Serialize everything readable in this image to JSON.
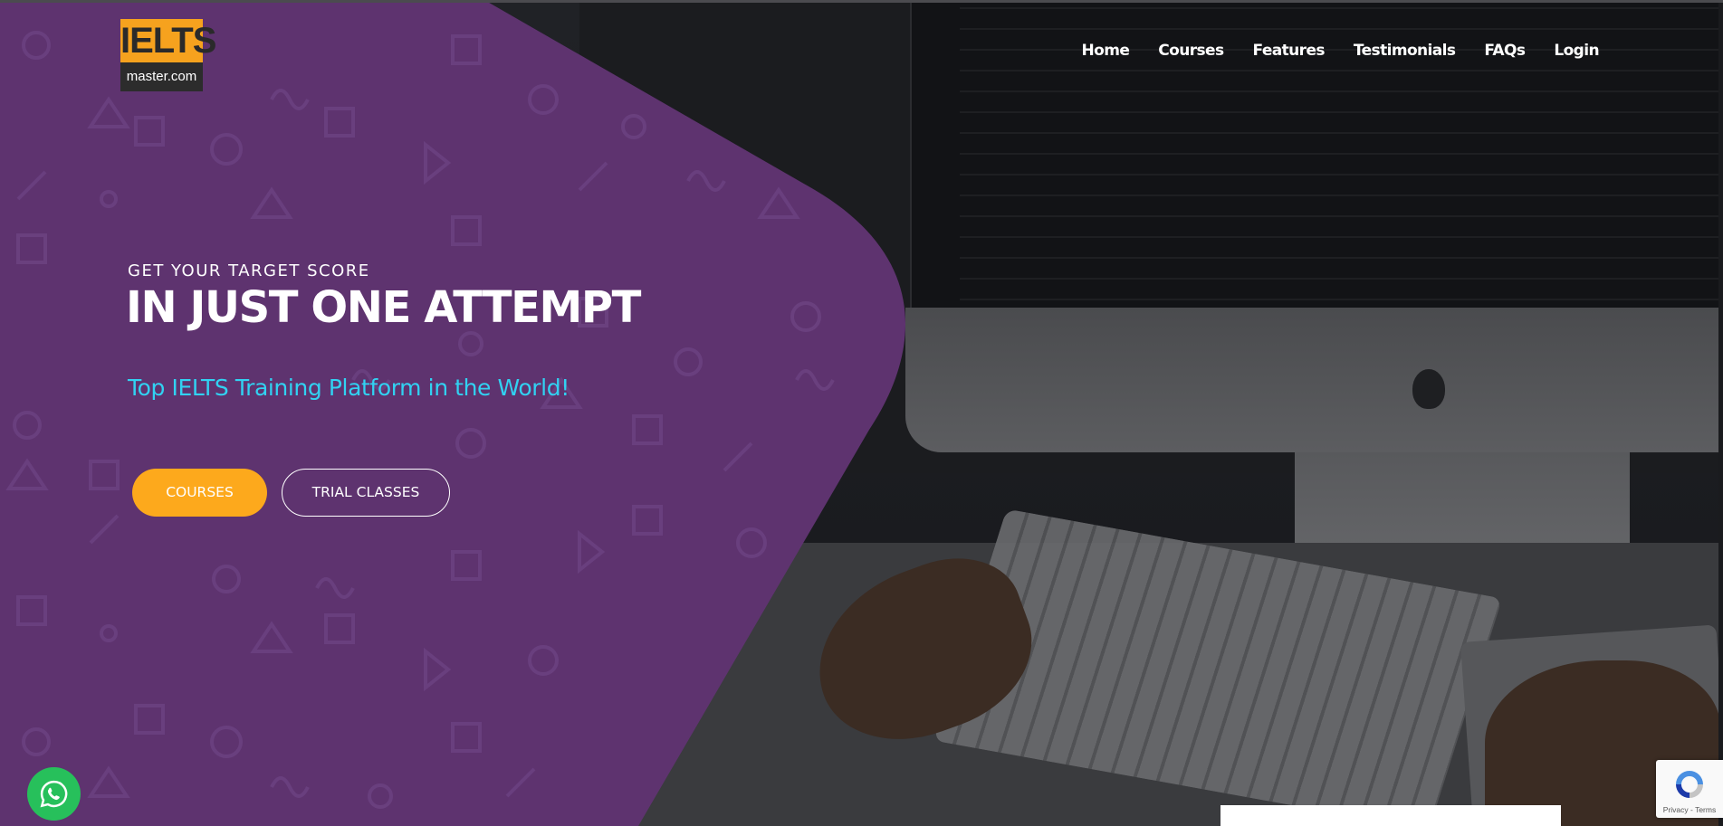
{
  "logo": {
    "top_text": "IELTS",
    "bottom_text": "master.com"
  },
  "nav": {
    "items": [
      {
        "label": "Home"
      },
      {
        "label": "Courses"
      },
      {
        "label": "Features"
      },
      {
        "label": "Testimonials"
      },
      {
        "label": "FAQs"
      },
      {
        "label": "Login"
      }
    ]
  },
  "hero": {
    "kicker": "GET YOUR TARGET SCORE",
    "headline": "IN JUST ONE ATTEMPT",
    "tagline": "Top IELTS Training Platform in the World!",
    "primary_button": "COURSES",
    "secondary_button": "TRIAL CLASSES"
  },
  "widgets": {
    "whatsapp_icon": "whatsapp-icon",
    "recaptcha_text": "Privacy - Terms",
    "recaptcha_icon": "recaptcha-icon"
  },
  "colors": {
    "purple_panel": "#5e336f",
    "accent_orange": "#fda91c",
    "tagline_cyan": "#31d2f2",
    "whatsapp_green": "#27c05b"
  }
}
